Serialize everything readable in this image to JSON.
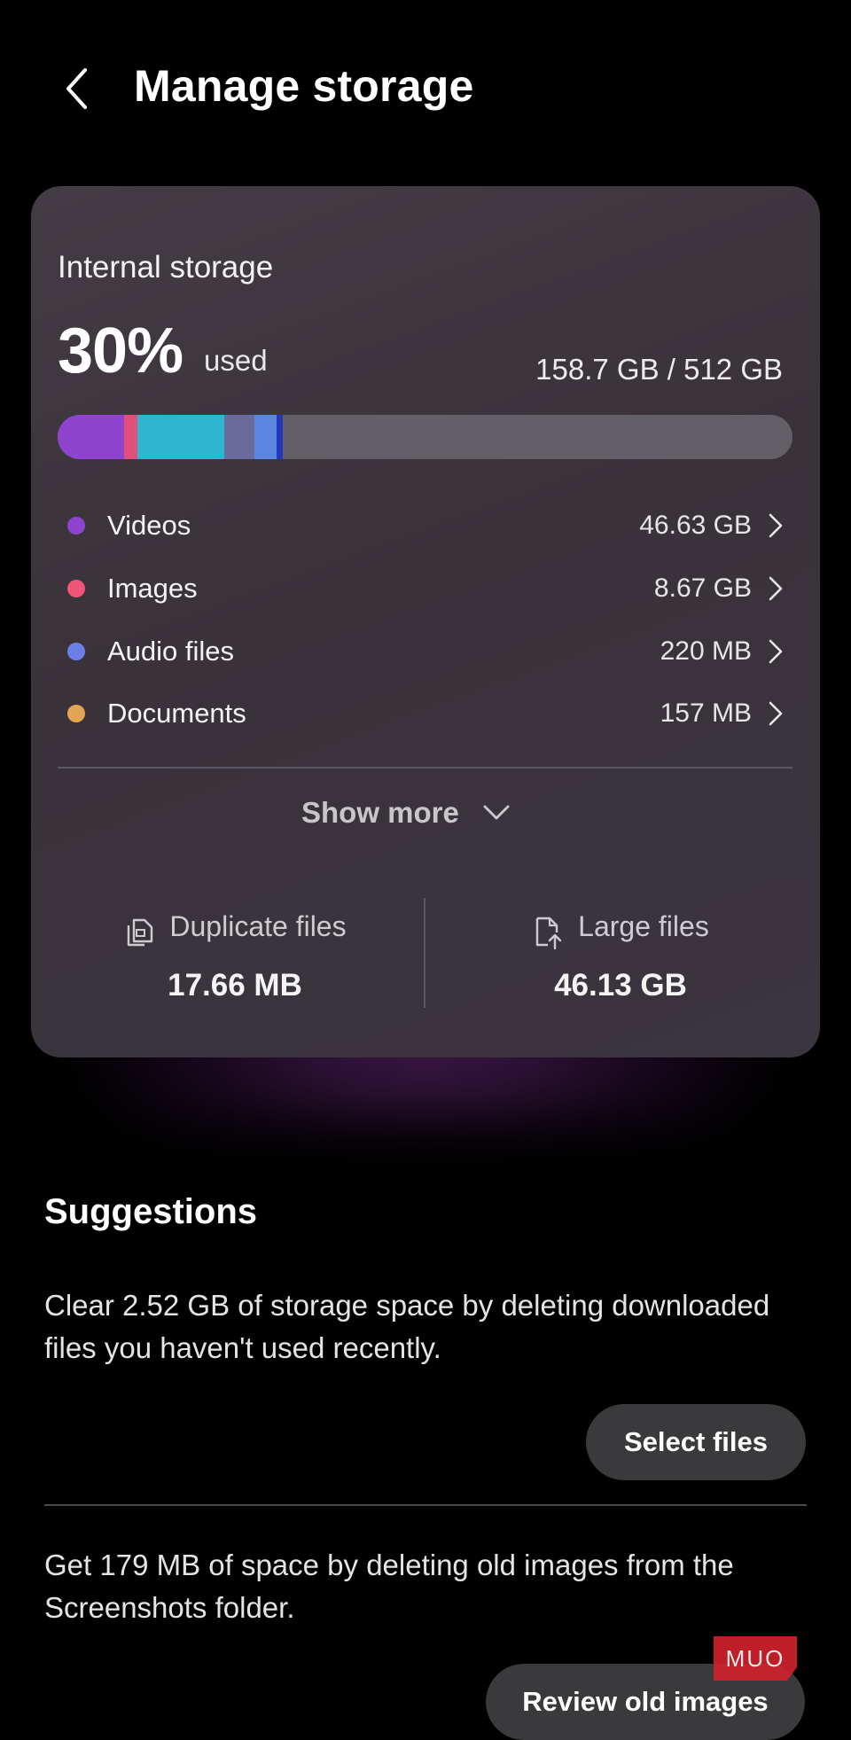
{
  "header": {
    "title": "Manage storage"
  },
  "storage": {
    "title": "Internal storage",
    "percent_used": "30%",
    "used_label": "used",
    "capacity": "158.7 GB / 512 GB",
    "bar_segments": [
      {
        "name": "Videos",
        "fraction": 0.091,
        "color": "#8e44cf"
      },
      {
        "name": "Images",
        "fraction": 0.017,
        "color": "#e0507a"
      },
      {
        "name": "Other-teal",
        "fraction": 0.119,
        "color": "#2fb6cf"
      },
      {
        "name": "Other-slate",
        "fraction": 0.041,
        "color": "#6a6a9c"
      },
      {
        "name": "Audio",
        "fraction": 0.03,
        "color": "#5a86e0"
      },
      {
        "name": "Other-blue",
        "fraction": 0.008,
        "color": "#2437b8"
      }
    ],
    "categories": [
      {
        "label": "Videos",
        "size": "46.63 GB",
        "color": "#8e44cf"
      },
      {
        "label": "Images",
        "size": "8.67 GB",
        "color": "#ee5577"
      },
      {
        "label": "Audio files",
        "size": "220 MB",
        "color": "#6c7fe6"
      },
      {
        "label": "Documents",
        "size": "157 MB",
        "color": "#e2a555"
      }
    ],
    "show_more": "Show more",
    "duplicate": {
      "label": "Duplicate files",
      "value": "17.66 MB",
      "icon": "duplicate-files-icon"
    },
    "large": {
      "label": "Large files",
      "value": "46.13 GB",
      "icon": "large-files-icon"
    }
  },
  "suggestions": {
    "title": "Suggestions",
    "items": [
      {
        "text": "Clear 2.52 GB of storage space by deleting downloaded files you haven't used recently.",
        "button": "Select files"
      },
      {
        "text": "Get 179 MB of space by deleting old images from the Screenshots folder.",
        "button": "Review old images"
      }
    ]
  },
  "watermark": "MUO"
}
